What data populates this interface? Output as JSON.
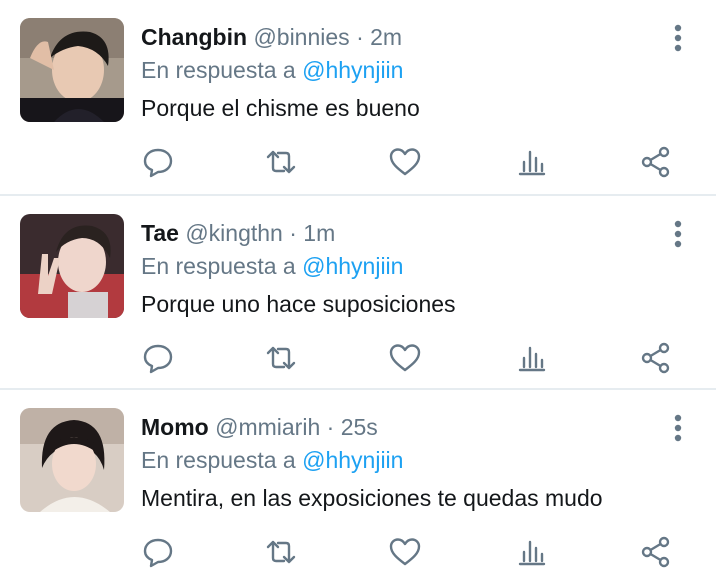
{
  "tweets": [
    {
      "name": "Changbin",
      "handle": "@binnies",
      "separator": "·",
      "time": "2m",
      "reply_prefix": "En respuesta a",
      "reply_to": "@hhynjiin",
      "text": "Porque el chisme es bueno"
    },
    {
      "name": "Tae",
      "handle": "@kingthn",
      "separator": "·",
      "time": "1m",
      "reply_prefix": "En respuesta a",
      "reply_to": "@hhynjiin",
      "text": "Porque uno hace suposiciones"
    },
    {
      "name": "Momo",
      "handle": "@mmiarih",
      "separator": "·",
      "time": "25s",
      "reply_prefix": "En respuesta a",
      "reply_to": "@hhynjiin",
      "text": "Mentira, en las exposiciones te quedas mudo"
    }
  ],
  "icons": {
    "more": "more-vertical-icon",
    "reply": "reply-icon",
    "retweet": "retweet-icon",
    "like": "heart-icon",
    "stats": "analytics-icon",
    "share": "share-icon"
  },
  "colors": {
    "text": "#14171a",
    "secondary": "#657786",
    "mention": "#1da1f2",
    "divider": "#e6ecf0"
  }
}
